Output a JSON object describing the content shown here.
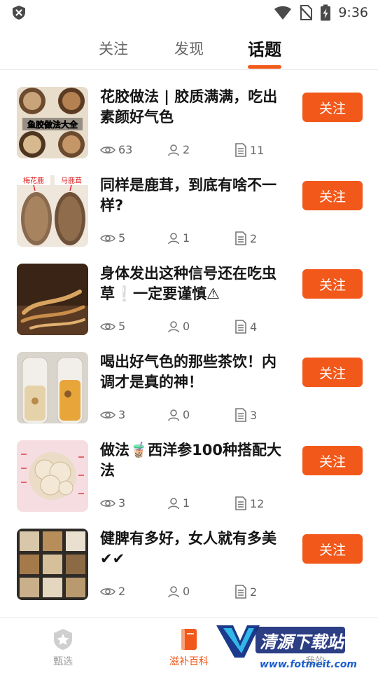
{
  "status_bar": {
    "time": "9:36"
  },
  "tabs": [
    {
      "label": "关注"
    },
    {
      "label": "发现"
    },
    {
      "label": "话题"
    }
  ],
  "topics": [
    {
      "title": "花胶做法 | 胶质满满，吃出素颜好气色",
      "thumb_caption": "鱼胶做法大全",
      "views": "63",
      "members": "2",
      "posts": "11",
      "follow_label": "关注"
    },
    {
      "title": "同样是鹿茸，到底有啥不一样?",
      "thumb_caption_left": "梅花鹿",
      "thumb_caption_right": "马鹿茸",
      "views": "5",
      "members": "1",
      "posts": "2",
      "follow_label": "关注"
    },
    {
      "title": "身体发出这种信号还在吃虫草❕一定要谨慎⚠",
      "views": "5",
      "members": "0",
      "posts": "4",
      "follow_label": "关注"
    },
    {
      "title": "喝出好气色的那些茶饮！内调才是真的神！",
      "views": "3",
      "members": "0",
      "posts": "3",
      "follow_label": "关注"
    },
    {
      "title": "做法🧋西洋参100种搭配大法",
      "views": "3",
      "members": "1",
      "posts": "12",
      "follow_label": "关注"
    },
    {
      "title": "健脾有多好，女人就有多美✔✔",
      "views": "2",
      "members": "0",
      "posts": "2",
      "follow_label": "关注"
    }
  ],
  "bottom_nav": [
    {
      "label": "甄选"
    },
    {
      "label": "滋补百科"
    },
    {
      "label": "我的"
    }
  ],
  "watermark": {
    "text": "清源下载站",
    "url": "www.fotmeit.com"
  },
  "colors": {
    "accent": "#f2581a",
    "text": "#151515",
    "muted": "#666666"
  }
}
